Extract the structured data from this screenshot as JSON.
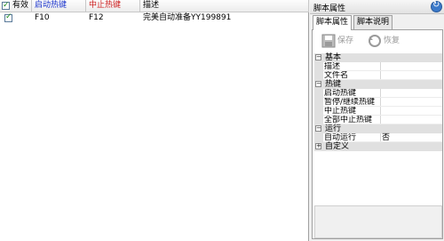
{
  "list": {
    "headers": {
      "enabled": "有效",
      "start_hotkey": "启动热键",
      "stop_hotkey": "中止热键",
      "description": "描述"
    },
    "colors": {
      "start_hotkey": "#1a33cc",
      "stop_hotkey": "#cc1a1a"
    },
    "rows": [
      {
        "enabled": true,
        "start_hotkey": "F10",
        "stop_hotkey": "F12",
        "description": "完美自动准备YY199891"
      }
    ]
  },
  "panel": {
    "title": "脚本属性",
    "tabs": [
      "脚本属性",
      "脚本说明"
    ],
    "toolbar": {
      "save_label": "保存",
      "restore_label": "恢复"
    },
    "grid": {
      "cat_basic": "基本",
      "prop_desc": "描述",
      "prop_desc_value": "",
      "prop_filename": "文件名",
      "prop_filename_value": "",
      "cat_hotkey": "热键",
      "prop_start": "启动热键",
      "prop_start_value": "",
      "prop_pause": "暂停/继续热键",
      "prop_pause_value": "",
      "prop_stop": "中止热键",
      "prop_stop_value": "",
      "prop_stopall": "全部中止热键",
      "prop_stopall_value": "",
      "cat_run": "运行",
      "prop_autorun": "自动运行",
      "prop_autorun_value": "否",
      "cat_custom": "自定义"
    }
  }
}
